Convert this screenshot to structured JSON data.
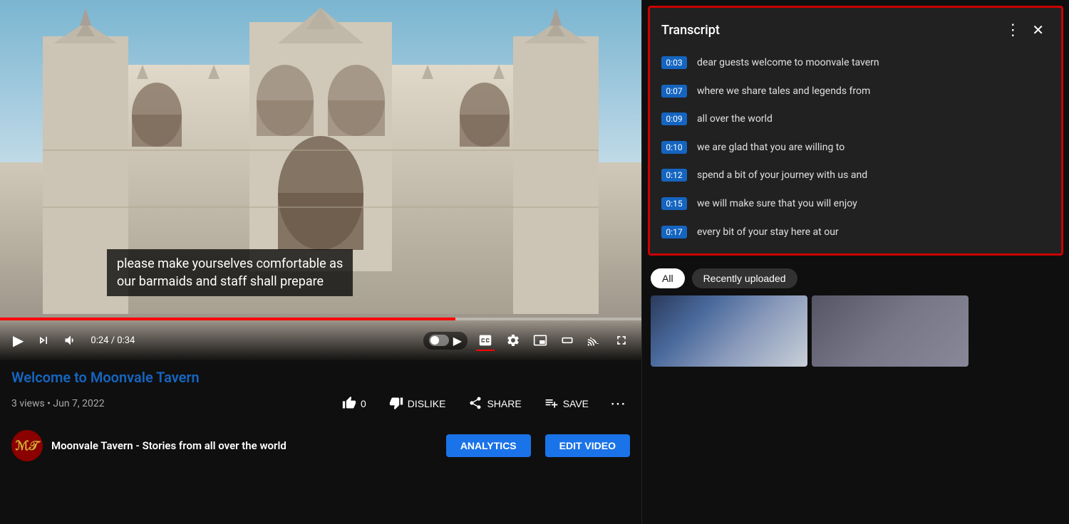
{
  "video": {
    "title": "Welcome to Moonvale Tavern",
    "views": "3 views",
    "date": "Jun 7, 2022",
    "current_time": "0:24",
    "total_time": "0:34",
    "progress_percent": 71,
    "subtitle": "please make yourselves comfortable as\nour barmaids and staff shall prepare",
    "like_count": "0",
    "dislike_label": "DISLIKE",
    "share_label": "SHARE",
    "save_label": "SAVE"
  },
  "channel": {
    "name": "Moonvale Tavern - Stories from all over the world",
    "avatar_text": "ℳ𝒯",
    "analytics_label": "ANALYTICS",
    "edit_video_label": "EDIT VIDEO"
  },
  "transcript": {
    "title": "Transcript",
    "close_label": "✕",
    "more_label": "⋮",
    "lines": [
      {
        "time": "0:03",
        "text": "dear guests welcome to moonvale tavern"
      },
      {
        "time": "0:07",
        "text": "where we share tales and legends from"
      },
      {
        "time": "0:09",
        "text": "all over the world"
      },
      {
        "time": "0:10",
        "text": "we are glad that you are willing to"
      },
      {
        "time": "0:12",
        "text": "spend a bit of your journey with us and"
      },
      {
        "time": "0:15",
        "text": "we will make sure that you will enjoy"
      },
      {
        "time": "0:17",
        "text": "every bit of your stay here at our"
      }
    ]
  },
  "filters": {
    "all_label": "All",
    "recently_uploaded_label": "Recently uploaded"
  },
  "controls": {
    "play_icon": "▶",
    "next_icon": "⏭",
    "volume_icon": "🔊",
    "autoplay_icon": "▶",
    "cc_icon": "CC",
    "settings_icon": "⚙",
    "miniplayer_icon": "⊡",
    "theatre_icon": "▭",
    "cast_icon": "⊓",
    "fullscreen_icon": "⛶"
  }
}
